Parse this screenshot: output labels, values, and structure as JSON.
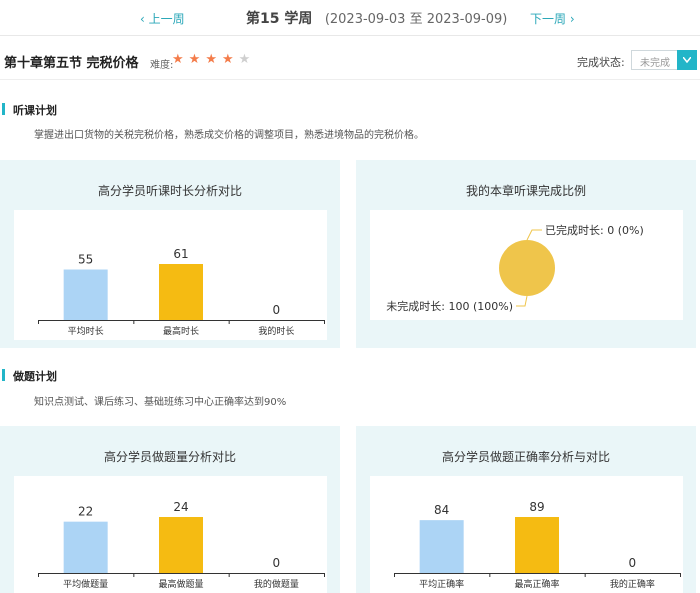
{
  "week": {
    "prev_label": "上一周",
    "week_label": "第15 学周",
    "date_range": "(2023-09-03 至 2023-09-09)",
    "next_label": "下一周"
  },
  "chapter": {
    "title": "第十章第五节 完税价格",
    "difficulty_label": "难度:",
    "difficulty_stars": 4,
    "difficulty_max": 5,
    "status_label": "完成状态:",
    "status_value": "未完成"
  },
  "listen_plan": {
    "title": "听课计划",
    "description": "掌握进出口货物的关税完税价格，熟悉成交价格的调整项目，熟悉进境物品的完税价格。"
  },
  "practice_plan": {
    "title": "做题计划",
    "description": "知识点测试、课后练习、基础班练习中心正确率达到90%"
  },
  "colors": {
    "accent": "#22b5c8",
    "bar_avg": "#acd4f5",
    "bar_max": "#f5bb12",
    "pie": "#efc54b",
    "panel_bg": "#eaf6f8"
  },
  "chart_data": [
    {
      "type": "bar",
      "title": "高分学员听课时长分析对比",
      "categories": [
        "平均时长",
        "最高时长",
        "我的时长"
      ],
      "values": [
        55,
        61,
        0
      ],
      "data_labels": [
        "55",
        "61",
        "0"
      ]
    },
    {
      "type": "pie",
      "title": "我的本章听课完成比例",
      "slices": [
        {
          "name": "已完成时长",
          "value": 0,
          "label": "已完成时长: 0 (0%)"
        },
        {
          "name": "未完成时长",
          "value": 100,
          "label": "未完成时长: 100 (100%)"
        }
      ]
    },
    {
      "type": "bar",
      "title": "高分学员做题量分析对比",
      "categories": [
        "平均做题量",
        "最高做题量",
        "我的做题量"
      ],
      "values": [
        22,
        24,
        0
      ],
      "data_labels": [
        "22",
        "24",
        "0"
      ]
    },
    {
      "type": "bar",
      "title": "高分学员做题正确率分析与对比",
      "categories": [
        "平均正确率",
        "最高正确率",
        "我的正确率"
      ],
      "values": [
        84,
        89,
        0
      ],
      "data_labels": [
        "84",
        "89",
        "0"
      ]
    }
  ]
}
